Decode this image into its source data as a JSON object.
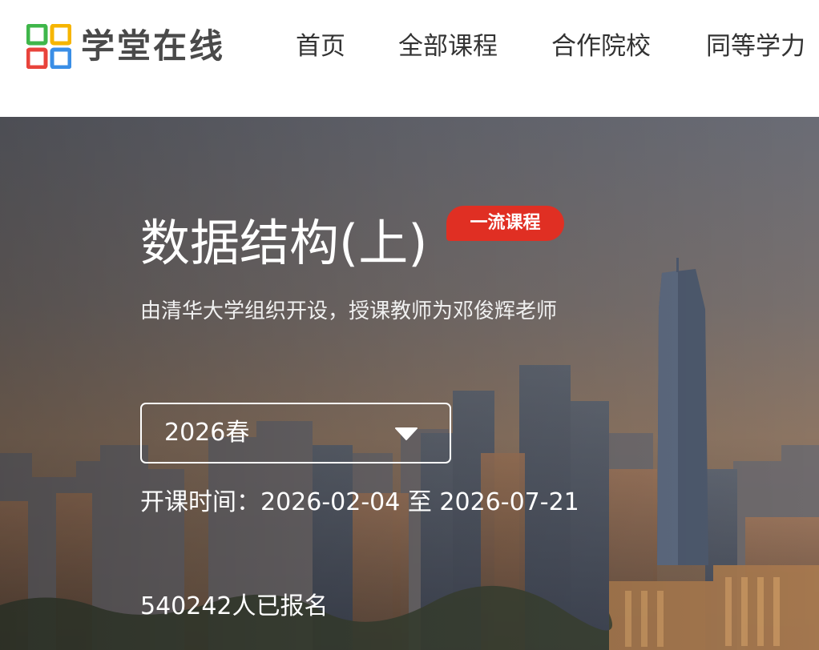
{
  "header": {
    "logo_text": "学堂在线",
    "nav": [
      {
        "label": "首页"
      },
      {
        "label": "全部课程"
      },
      {
        "label": "合作院校"
      },
      {
        "label": "同等学力"
      }
    ]
  },
  "course": {
    "title": "数据结构(上)",
    "badge": "一流课程",
    "subtitle": "由清华大学组织开设，授课教师为邓俊辉老师",
    "term_selected": "2026春",
    "schedule": "开课时间：2026-02-04 至 2026-07-21",
    "enrolled": "540242人已报名"
  },
  "icons": {
    "logo": "xuetangx-logo-icon",
    "dropdown": "chevron-down-icon"
  },
  "colors": {
    "badge": "#e02f23",
    "logo_green": "#3fb64a",
    "logo_yellow": "#f6b500",
    "logo_red": "#e8433b",
    "logo_blue": "#3a8ee6"
  }
}
